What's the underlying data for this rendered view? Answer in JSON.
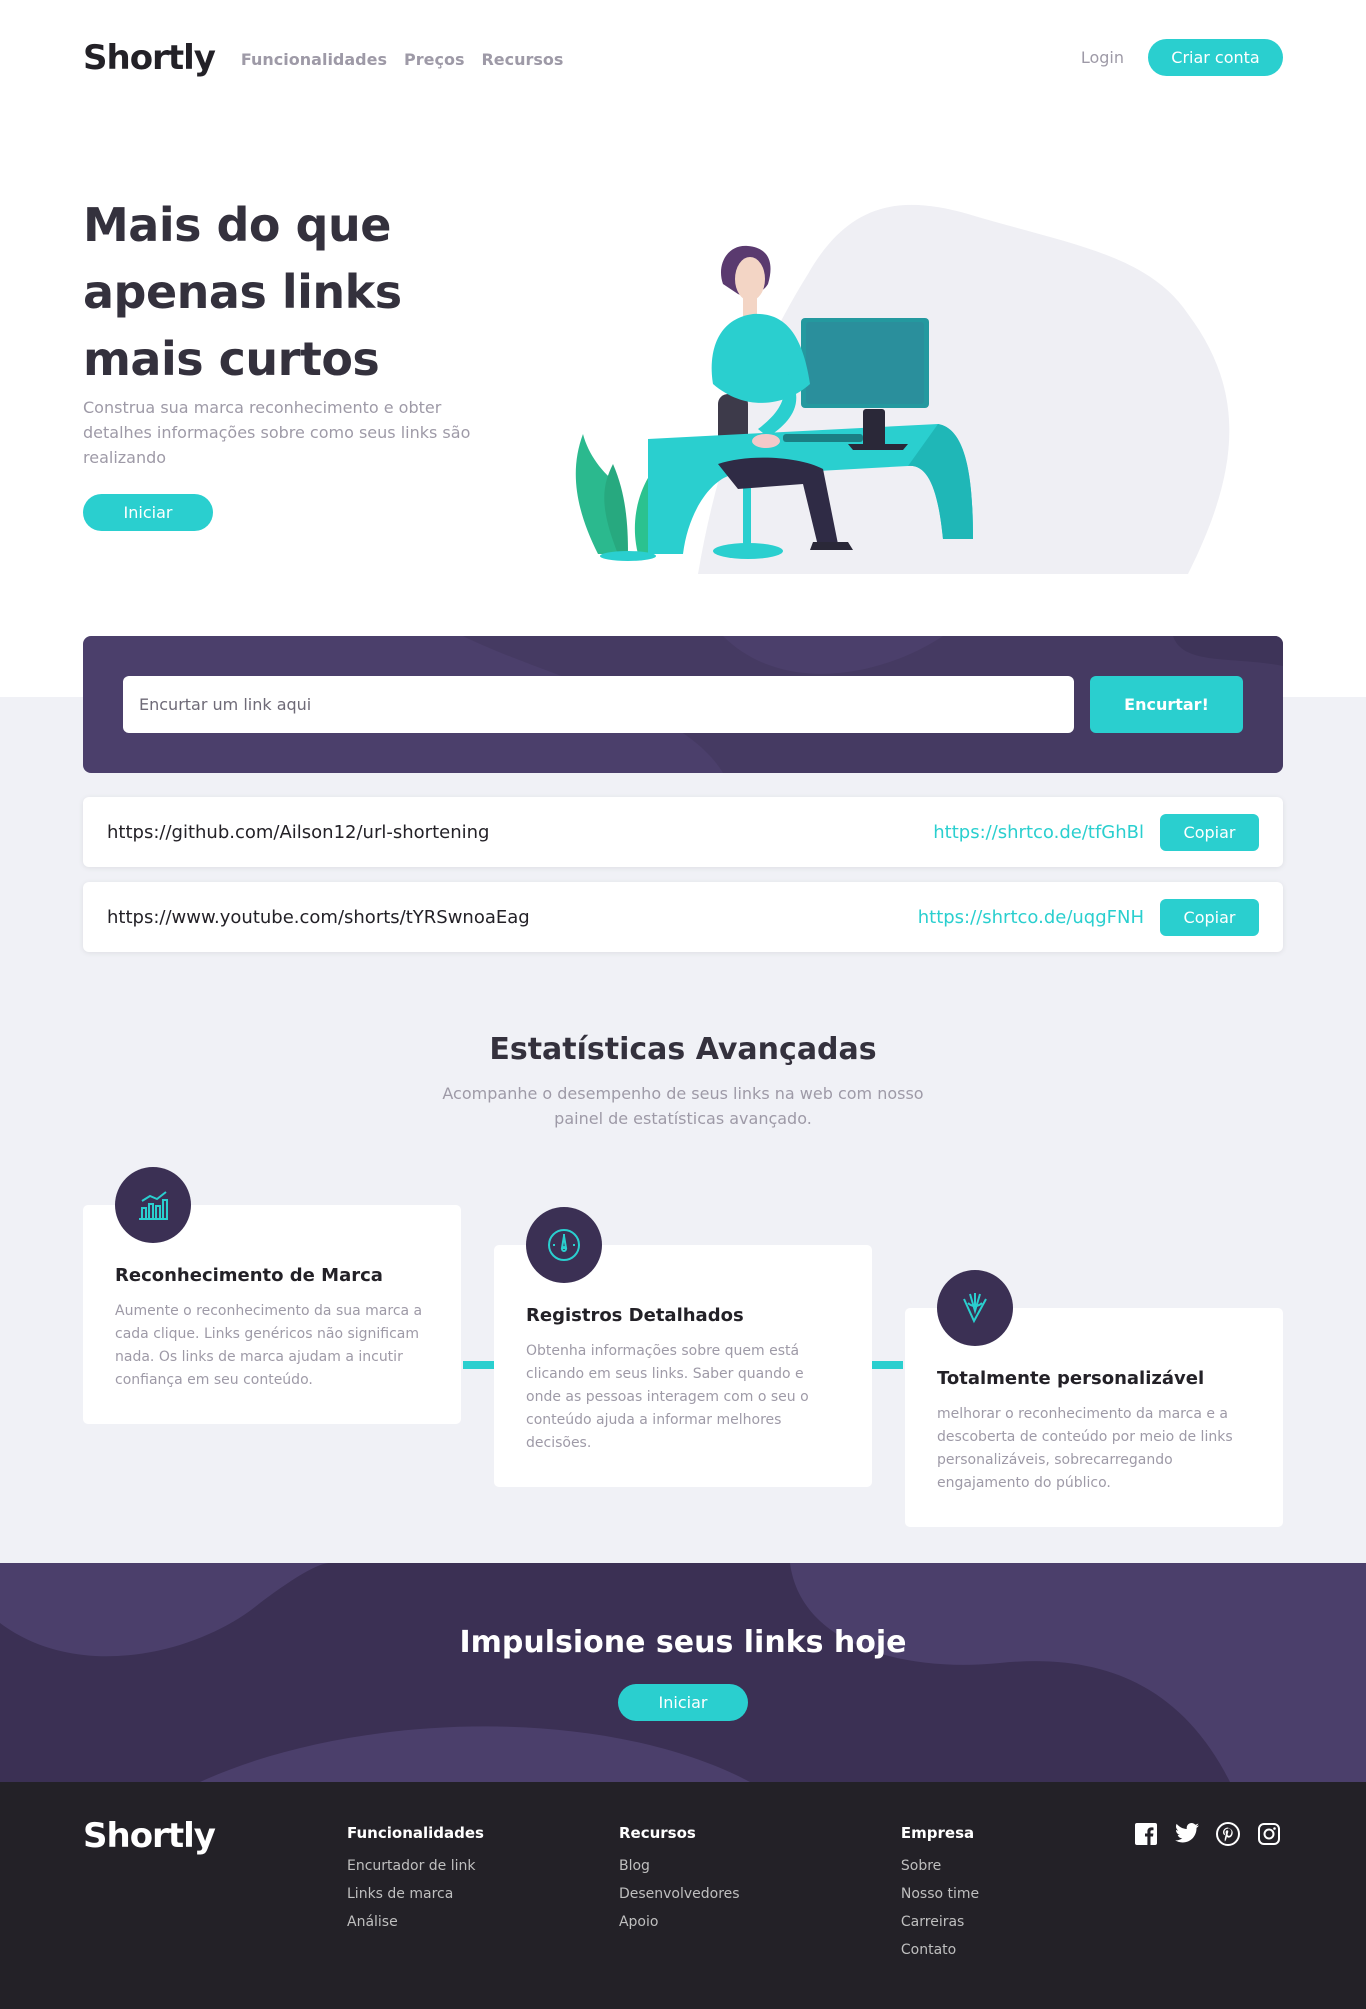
{
  "brand": "Shortly",
  "nav": {
    "items": [
      "Funcionalidades",
      "Preços",
      "Recursos"
    ],
    "login": "Login",
    "signup": "Criar conta"
  },
  "hero": {
    "title": "Mais do que apenas links mais curtos",
    "text": "Construa sua marca reconhecimento e obter detalhes informações sobre como seus links são realizando",
    "cta": "Iniciar"
  },
  "shortener": {
    "placeholder": "Encurtar um link aqui",
    "button": "Encurtar!"
  },
  "results": [
    {
      "original": "https://github.com/Ailson12/url-shortening",
      "short": "https://shrtco.de/tfGhBl",
      "copy": "Copiar"
    },
    {
      "original": "https://www.youtube.com/shorts/tYRSwnoaEag",
      "short": "https://shrtco.de/uqgFNH",
      "copy": "Copiar"
    }
  ],
  "stats": {
    "title": "Estatísticas Avançadas",
    "subtitle": "Acompanhe o desempenho de seus links na web com nosso painel de estatísticas avançado.",
    "cards": [
      {
        "icon": "bar-chart-icon",
        "title": "Reconhecimento de Marca",
        "text": "Aumente o reconhecimento da sua marca a cada clique. Links genéricos não significam nada. Os links de marca ajudam a incutir confiança em seu conteúdo."
      },
      {
        "icon": "gauge-icon",
        "title": "Registros Detalhados",
        "text": "Obtenha informações sobre quem está clicando em seus links. Saber quando e onde as pessoas interagem com o seu o conteúdo ajuda a informar melhores decisões."
      },
      {
        "icon": "brush-tools-icon",
        "title": "Totalmente personalizável",
        "text": "melhorar o reconhecimento da marca e a descoberta de conteúdo por meio de links personalizáveis, sobrecarregando engajamento do público."
      }
    ]
  },
  "boost": {
    "title": "Impulsione seus links hoje",
    "cta": "Iniciar"
  },
  "footer": {
    "brand": "Shortly",
    "columns": [
      {
        "title": "Funcionalidades",
        "links": [
          "Encurtador de link",
          "Links de marca",
          "Análise"
        ]
      },
      {
        "title": "Recursos",
        "links": [
          "Blog",
          "Desenvolvedores",
          "Apoio"
        ]
      },
      {
        "title": "Empresa",
        "links": [
          "Sobre",
          "Nosso time",
          "Carreiras",
          "Contato"
        ]
      }
    ],
    "socials": [
      "facebook-icon",
      "twitter-icon",
      "pinterest-icon",
      "instagram-icon"
    ]
  },
  "colors": {
    "accent": "#2acfcf",
    "dark_violet": "#3b3054",
    "very_dark": "#232127",
    "gray_bg": "#f0f1f6"
  }
}
